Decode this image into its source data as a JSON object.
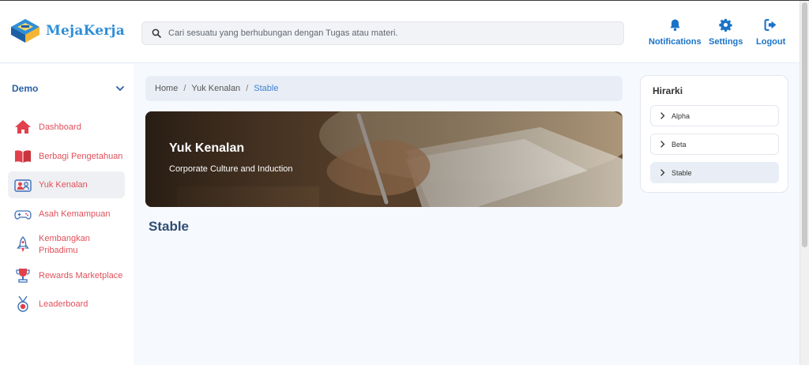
{
  "header": {
    "logo_text": "MejaKerja",
    "search_placeholder": "Cari sesuatu yang berhubungan dengan Tugas atau materi.",
    "buttons": [
      {
        "label": "Notifications",
        "icon": "bell-icon"
      },
      {
        "label": "Settings",
        "icon": "gear-icon"
      },
      {
        "label": "Logout",
        "icon": "logout-icon"
      }
    ]
  },
  "sidebar": {
    "group_label": "Demo",
    "items": [
      {
        "label": "Dashboard",
        "icon": "home-icon"
      },
      {
        "label": "Berbagi Pengetahuan",
        "icon": "book-icon"
      },
      {
        "label": "Yuk Kenalan",
        "icon": "people-icon",
        "active": true
      },
      {
        "label": "Asah Kemampuan",
        "icon": "gamepad-icon"
      },
      {
        "label": "Kembangkan Pribadimu",
        "icon": "rocket-icon"
      },
      {
        "label": "Rewards Marketplace",
        "icon": "trophy-icon"
      },
      {
        "label": "Leaderboard",
        "icon": "medal-icon"
      }
    ]
  },
  "breadcrumb": {
    "items": [
      "Home",
      "Yuk Kenalan",
      "Stable"
    ],
    "separator": "/"
  },
  "banner": {
    "title": "Yuk Kenalan",
    "subtitle": "Corporate Culture and Induction"
  },
  "main": {
    "page_title": "Stable"
  },
  "hirarki": {
    "title": "Hirarki",
    "items": [
      "Alpha",
      "Beta",
      "Stable"
    ],
    "active": "Stable"
  },
  "colors": {
    "brand_blue": "#1a73c9",
    "nav_text_red": "#e0505a",
    "accent_link": "#3d7fd1"
  }
}
